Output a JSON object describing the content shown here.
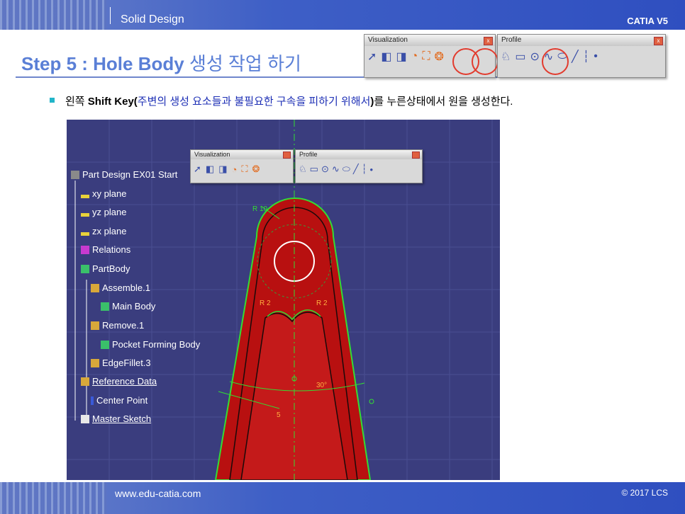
{
  "header": {
    "section": "Solid Design",
    "brand": "CATIA V5"
  },
  "title": {
    "step": "Step 5 : Hole Body",
    "korean": "생성 작업 하기"
  },
  "instruction": {
    "prefix": "왼쪽 ",
    "key": "Shift Key",
    "open": "(",
    "note": "주변의 생성 요소들과 불필요한 구속을 피하기 위해서",
    "close": ")",
    "suffix": "를 누른상태에서 원을 생성한다."
  },
  "toolbars": {
    "visualization": {
      "title": "Visualization",
      "close": "x"
    },
    "profile": {
      "title": "Profile",
      "close": "x"
    }
  },
  "inset_toolbars": {
    "visualization": {
      "title": "Visualization"
    },
    "profile": {
      "title": "Profile"
    }
  },
  "tree": {
    "root": "Part Design EX01 Start",
    "items": [
      {
        "label": "xy plane"
      },
      {
        "label": "yz plane"
      },
      {
        "label": "zx plane"
      },
      {
        "label": "Relations"
      },
      {
        "label": "PartBody"
      },
      {
        "label": "Assemble.1"
      },
      {
        "label": "Main Body"
      },
      {
        "label": "Remove.1"
      },
      {
        "label": "Pocket Forming Body"
      },
      {
        "label": "EdgeFillet.3"
      },
      {
        "label": "Reference Data"
      },
      {
        "label": "Center Point"
      },
      {
        "label": "Master Sketch"
      }
    ]
  },
  "sketch": {
    "r10": "R 10",
    "r2a": "R 2",
    "r2b": "R 2",
    "angle": "30°",
    "dim5": "5"
  },
  "footer": {
    "url": "www.edu-catia.com",
    "copyright": "© 2017 LCS"
  },
  "colors": {
    "accent": "#5a7fd6",
    "part_red": "#c01818",
    "sketch_green": "#33dd33",
    "viewport_bg": "#3a3d7e"
  }
}
